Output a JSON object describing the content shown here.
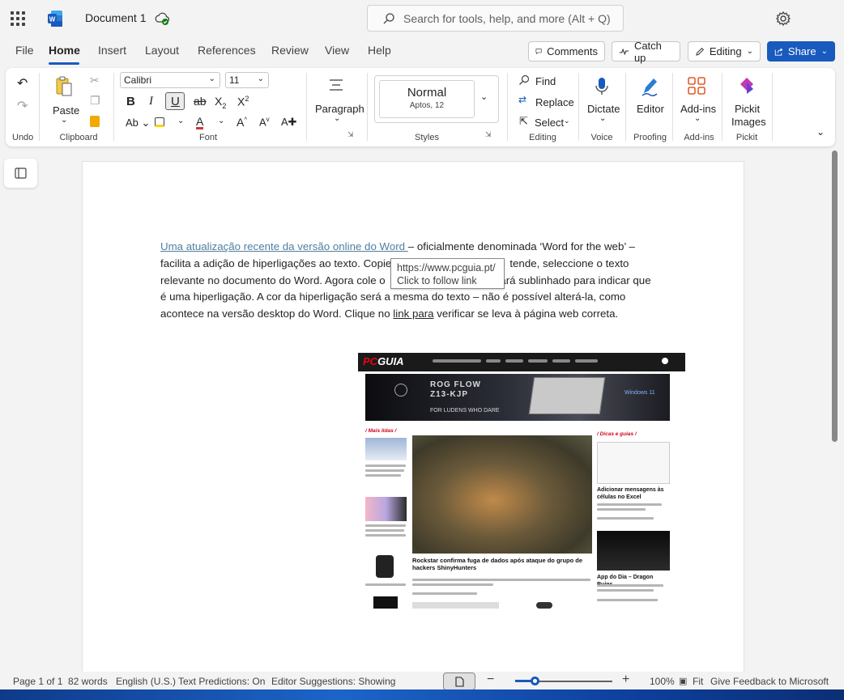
{
  "app": {
    "document_title": "Document 1",
    "search_placeholder": "Search for tools, help, and more (Alt + Q)"
  },
  "tabs": [
    "File",
    "Home",
    "Insert",
    "Layout",
    "References",
    "Review",
    "View",
    "Help"
  ],
  "top_buttons": {
    "comments": "Comments",
    "catch_up": "Catch up",
    "editing": "Editing",
    "share": "Share"
  },
  "ribbon": {
    "groups": {
      "undo": "Undo",
      "clipboard": "Clipboard",
      "font": "Font",
      "paragraph_group": "",
      "styles": "Styles",
      "editing": "Editing",
      "voice": "Voice",
      "proofing": "Proofing",
      "addins": "Add-ins",
      "pickit": "Pickit"
    },
    "paste_label": "Paste",
    "font_name": "Calibri",
    "font_size": "11",
    "paragraph_label": "Paragraph",
    "style_name": "Normal",
    "style_sub": "Aptos, 12",
    "find_label": "Find",
    "replace_label": "Replace",
    "select_label": "Select",
    "dictate_label": "Dictate",
    "editor_label": "Editor",
    "addins_label": "Add-ins",
    "pickit_label_1": "Pickit",
    "pickit_label_2": "Images"
  },
  "document": {
    "link_text": "Uma atualização recente da versão online do Word ",
    "line1_rest": "– oficialmente denominada ‘Word for the web’ –",
    "line2": "facilita a adição de hiperligações ao texto. Copie",
    "line2_tail": "tende, seleccione o texto",
    "line3": "relevante no documento do Word. Agora cole o",
    "line3_tail": "icará sublinhado para indicar que",
    "line4": "é uma hiperligação. A cor da hiperligação será a mesma do texto – não é possível alterá-la, como",
    "line5_a": "acontece na versão desktop do Word. Clique no ",
    "line5_link": "link  para",
    "line5_b": " verificar se leva à página web correta.",
    "tooltip_url": "https://www.pcguia.pt/",
    "tooltip_hint": "Click to follow link"
  },
  "embedded_site": {
    "logo_pc": "PC",
    "logo_rest": "GUIA",
    "banner_line1": "ROG FLOW",
    "banner_line2": "Z13-KJP",
    "banner_line3": "FOR LUDENS WHO DARE",
    "banner_windows": "Windows 11",
    "section_left": "/ Mais lidas /",
    "section_right": "/ Dicas e guias /",
    "main_headline": "Rockstar confirma fuga de dados após ataque do grupo de hackers ShinyHunters",
    "right_caption_1": "Adicionar mensagens às células no Excel",
    "right_caption_2": "App do Dia – Dragon Ruins"
  },
  "status": {
    "page": "Page 1 of 1",
    "words": "82 words",
    "language": "English (U.S.)",
    "text_predictions": "Text Predictions: On",
    "editor_suggestions": "Editor Suggestions: Showing",
    "zoom": "100%",
    "fit": "Fit",
    "feedback": "Give Feedback to Microsoft"
  },
  "colors": {
    "accent": "#185abd",
    "link": "#4f7fa0"
  }
}
